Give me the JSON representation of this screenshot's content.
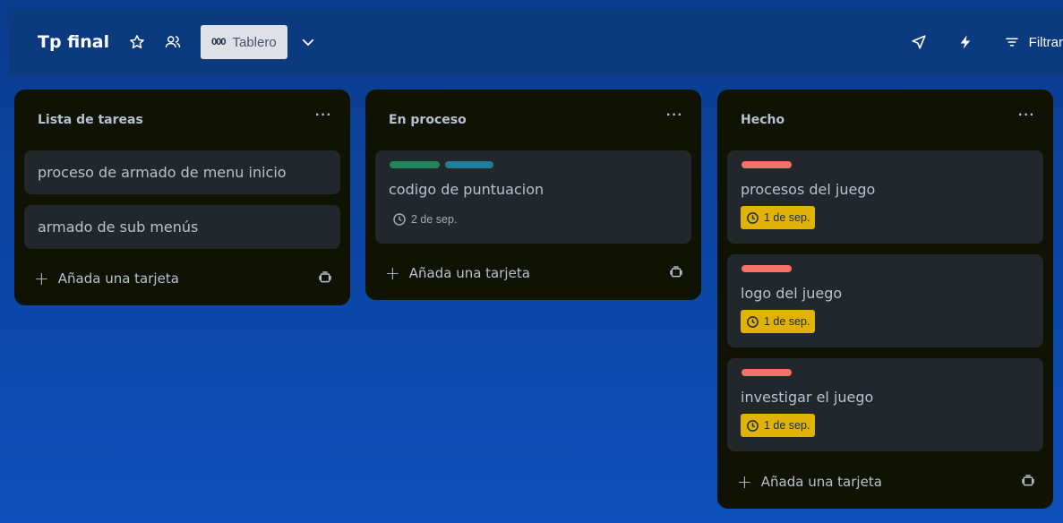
{
  "board": {
    "title": "Tp final",
    "view_label": "Tablero",
    "view_icon": "000",
    "filter_label": "Filtrar"
  },
  "lists": [
    {
      "title": "Lista de tareas",
      "menu": "···",
      "cards": [
        {
          "title": "proceso de armado de menu inicio"
        },
        {
          "title": "armado de sub menús"
        }
      ],
      "add_label": "Añada una tarjeta"
    },
    {
      "title": "En proceso",
      "menu": "···",
      "cards": [
        {
          "title": "codigo de puntuacion",
          "labels": [
            "#1f845a",
            "#227d9b"
          ],
          "due": "2 de sep."
        }
      ],
      "add_label": "Añada una tarjeta"
    },
    {
      "title": "Hecho",
      "menu": "···",
      "cards": [
        {
          "title": "procesos del juego",
          "labels": [
            "#f87168"
          ],
          "due": "1 de sep."
        },
        {
          "title": "logo del juego",
          "labels": [
            "#f87168"
          ],
          "due": "1 de sep."
        },
        {
          "title": "investigar el juego",
          "labels": [
            "#f87168"
          ],
          "due": "1 de sep."
        }
      ],
      "add_label": "Añada una tarjeta"
    }
  ],
  "colors": {
    "due_badge": "#e2b203",
    "list_bg": "#101204",
    "card_bg": "#22272b"
  }
}
